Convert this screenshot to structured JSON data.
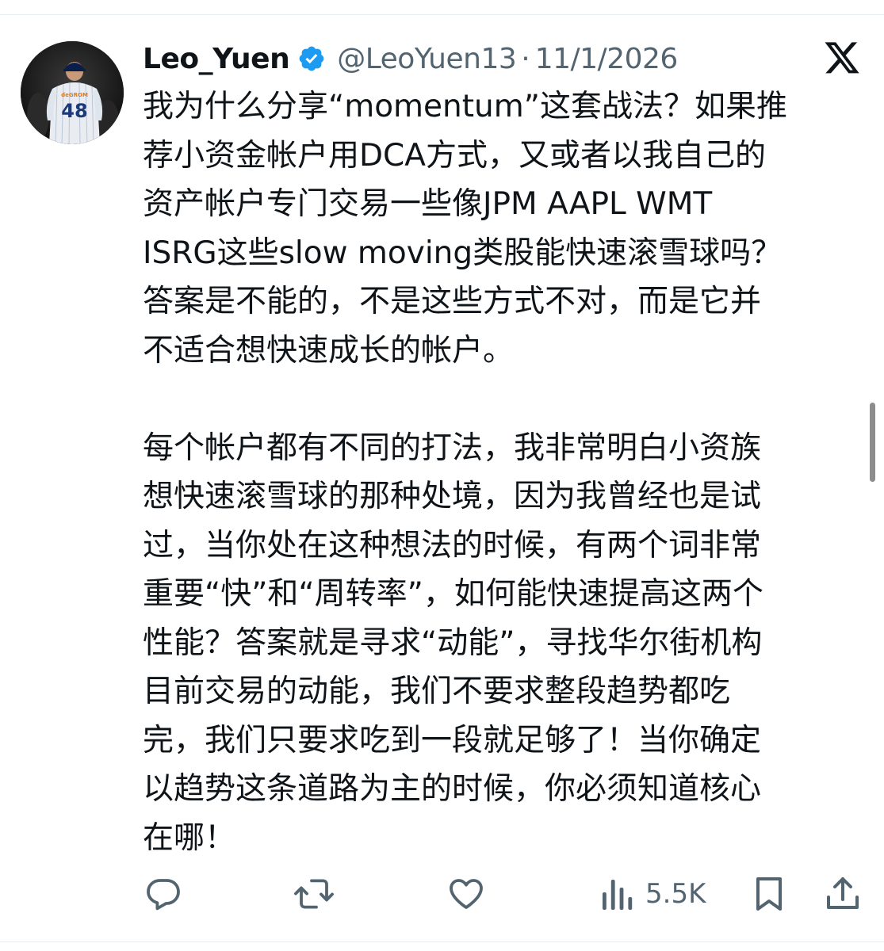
{
  "tweet": {
    "author": {
      "display_name": "Leo_Yuen",
      "handle": "@LeoYuen13",
      "verified": true,
      "avatar_jersey_number": "48",
      "avatar_jersey_name": "deGROM"
    },
    "separator": "·",
    "date": "11/1/2026",
    "paragraphs": [
      {
        "lines": [
          "我为什么分享“momentum”这套战法？如果推",
          "荐小资金帐户用DCA方式，又或者以我自己的",
          "资产帐户专门交易一些像JPM AAPL WMT",
          "ISRG这些slow moving类股能快速滚雪球吗？",
          "答案是不能的，不是这些方式不对，而是它并",
          "不适合想快速成长的帐户。"
        ]
      },
      {
        "lines": [
          "每个帐户都有不同的打法，我非常明白小资族",
          "想快速滚雪球的那种处境，因为我曾经也是试",
          "过，当你处在这种想法的时候，有两个词非常",
          "重要“快”和“周转率”，如何能快速提高这两个",
          "性能？答案就是寻求“动能”，寻找华尔街机构",
          "目前交易的动能，我们不要求整段趋势都吃",
          "完，我们只要求吃到一段就足够了！当你确定",
          "以趋势这条道路为主的时候，你必须知道核心",
          "在哪！"
        ]
      }
    ],
    "actions": {
      "reply_icon": "reply-icon",
      "retweet_icon": "retweet-icon",
      "like_icon": "heart-icon",
      "views_icon": "views-icon",
      "views_count": "5.5K",
      "bookmark_icon": "bookmark-icon",
      "share_icon": "share-icon"
    },
    "colors": {
      "text": "#0f1419",
      "secondary": "#536471",
      "verified_blue": "#1d9bf0"
    }
  }
}
